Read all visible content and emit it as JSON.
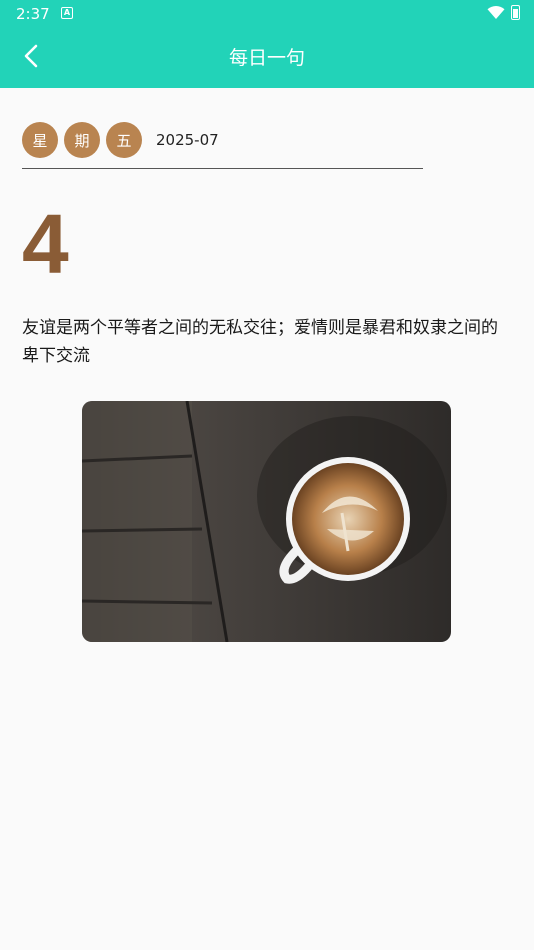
{
  "status_bar": {
    "time": "2:37",
    "app_icon": "letter-a-icon",
    "wifi_icon": "wifi-icon",
    "battery_icon": "battery-icon"
  },
  "toolbar": {
    "title": "每日一句",
    "back_icon": "chevron-left-icon"
  },
  "date": {
    "weekday_chars": [
      "星",
      "期",
      "五"
    ],
    "month": "2025-07",
    "day": "4"
  },
  "quote": {
    "text": "友谊是两个平等者之间的无私交往；爱情则是暴君和奴隶之间的卑下交流"
  },
  "image": {
    "subject": "latte-art-coffee-cup-on-wooden-table"
  },
  "colors": {
    "accent": "#22d3b8",
    "weekday_badge": "#b98450",
    "day_number": "#8a5c36"
  }
}
